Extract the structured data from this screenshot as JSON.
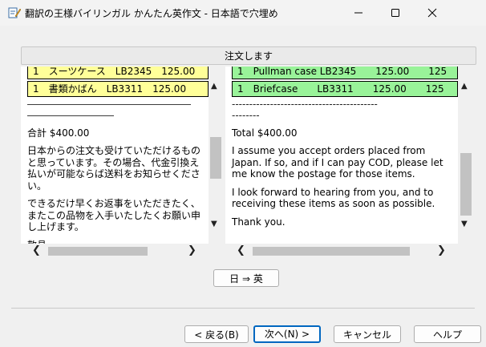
{
  "window": {
    "title": "翻訳の王様バイリンガル かんたん英作文 - 日本語で穴埋め",
    "icons": {
      "app": "app-pencil-icon",
      "minimize": "minimize-icon",
      "maximize": "maximize-icon",
      "close": "close-icon"
    }
  },
  "header": {
    "label": "注文します"
  },
  "left_pane": {
    "rows": [
      "1　スーツケース　LB2345　125.00",
      "1　書類かばん　LB3311　125.00"
    ],
    "divider_long": "―――――――――――――――――",
    "divider_short": "―――――――――",
    "total": "合計 $400.00",
    "para1": "日本からの注文も受けていただけるものと思っています。その場合、代金引換え払いが可能ならば送料をお知らせください。",
    "para2": "できるだけ早くお返事をいただきたく、またこの品物を入手いたしたくお願い申し上げます。",
    "cut_line": "敬具"
  },
  "right_pane": {
    "rows": [
      "1　Pullman case LB2345　　125.00　　125",
      "1　Briefcase　　LB3311　　125.00　　125"
    ],
    "divider_long": "------------------------------------------",
    "divider_short": "--------",
    "total": "Total $400.00",
    "para1": "I assume you accept orders placed from Japan. If so, and if I can pay COD, please let me know the postage for those items.",
    "para2": "I look forward to hearing from you, and to receiving these items as soon as possible.",
    "para3": "Thank you."
  },
  "scroll_icons": {
    "up": "▲",
    "down": "▼",
    "left": "❮",
    "right": "❯"
  },
  "buttons": {
    "lang": "日 ⇒ 英",
    "back": "< 戻る(B)",
    "next": "次へ(N) >",
    "cancel": "キャンセル",
    "help": "ヘルプ"
  }
}
